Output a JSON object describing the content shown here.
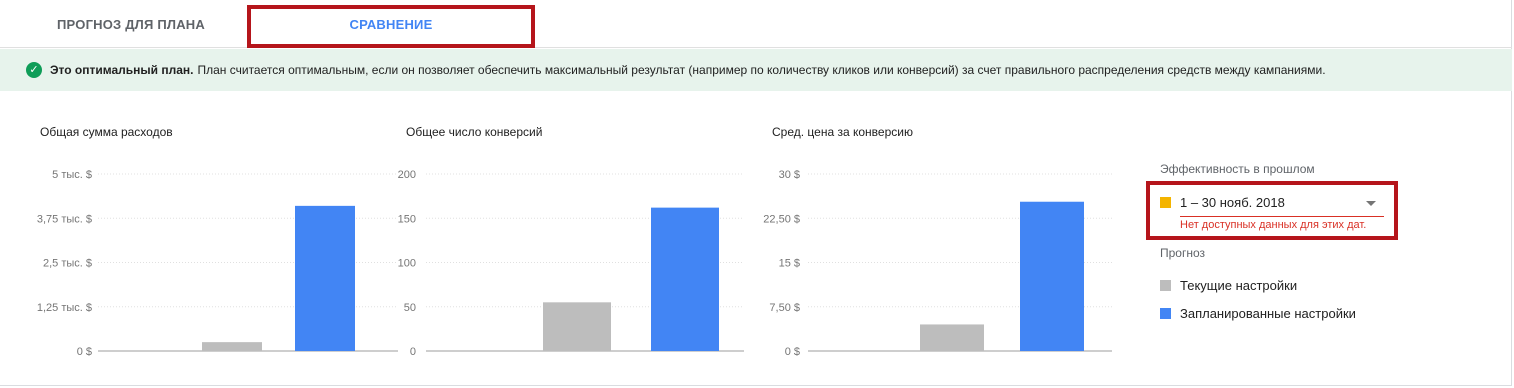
{
  "tabs": [
    {
      "label": "ПРОГНОЗ ДЛЯ ПЛАНА"
    },
    {
      "label": "СРАВНЕНИЕ"
    }
  ],
  "banner": {
    "bold": "Это оптимальный план.",
    "text": "План считается оптимальным, если он позволяет обеспечить максимальный результат (например по количеству кликов или конверсий) за счет правильного распределения средств между кампаниями.",
    "icon": "check-circle-icon"
  },
  "colors": {
    "accent": "#4285f4",
    "current": "#bdbdbd",
    "planned": "#4285f4",
    "past": "#f4b400",
    "error": "#d93025",
    "success": "#0f9d58",
    "highlight": "#b5151b"
  },
  "chart_data": [
    {
      "type": "bar",
      "title": "Общая сумма расходов",
      "ylim": [
        0,
        5000
      ],
      "ticks": [
        0,
        1250,
        2500,
        3750,
        5000
      ],
      "tick_labels": [
        "0 $",
        "1,25 тыс. $",
        "2,5 тыс. $",
        "3,75 тыс. $",
        "5 тыс. $"
      ],
      "series": [
        {
          "name": "Текущие настройки",
          "values": [
            250
          ]
        },
        {
          "name": "Запланированные настройки",
          "values": [
            4100
          ]
        }
      ]
    },
    {
      "type": "bar",
      "title": "Общее число конверсий",
      "ylim": [
        0,
        200
      ],
      "ticks": [
        0,
        50,
        100,
        150,
        200
      ],
      "tick_labels": [
        "0",
        "50",
        "100",
        "150",
        "200"
      ],
      "series": [
        {
          "name": "Текущие настройки",
          "values": [
            55
          ]
        },
        {
          "name": "Запланированные настройки",
          "values": [
            162
          ]
        }
      ]
    },
    {
      "type": "bar",
      "title": "Сред. цена за конверсию",
      "ylim": [
        0,
        30
      ],
      "ticks": [
        0,
        7.5,
        15,
        22.5,
        30
      ],
      "tick_labels": [
        "0 $",
        "7,50 $",
        "15 $",
        "22,50 $",
        "30 $"
      ],
      "series": [
        {
          "name": "Текущие настройки",
          "values": [
            4.5
          ]
        },
        {
          "name": "Запланированные настройки",
          "values": [
            25.3
          ]
        }
      ]
    }
  ],
  "legend": {
    "past_caption": "Эффективность в прошлом",
    "date_range": "1 – 30 нояб. 2018",
    "error": "Нет доступных данных для этих дат.",
    "forecast_caption": "Прогноз",
    "items": [
      {
        "label": "Текущие настройки"
      },
      {
        "label": "Запланированные настройки"
      }
    ]
  }
}
